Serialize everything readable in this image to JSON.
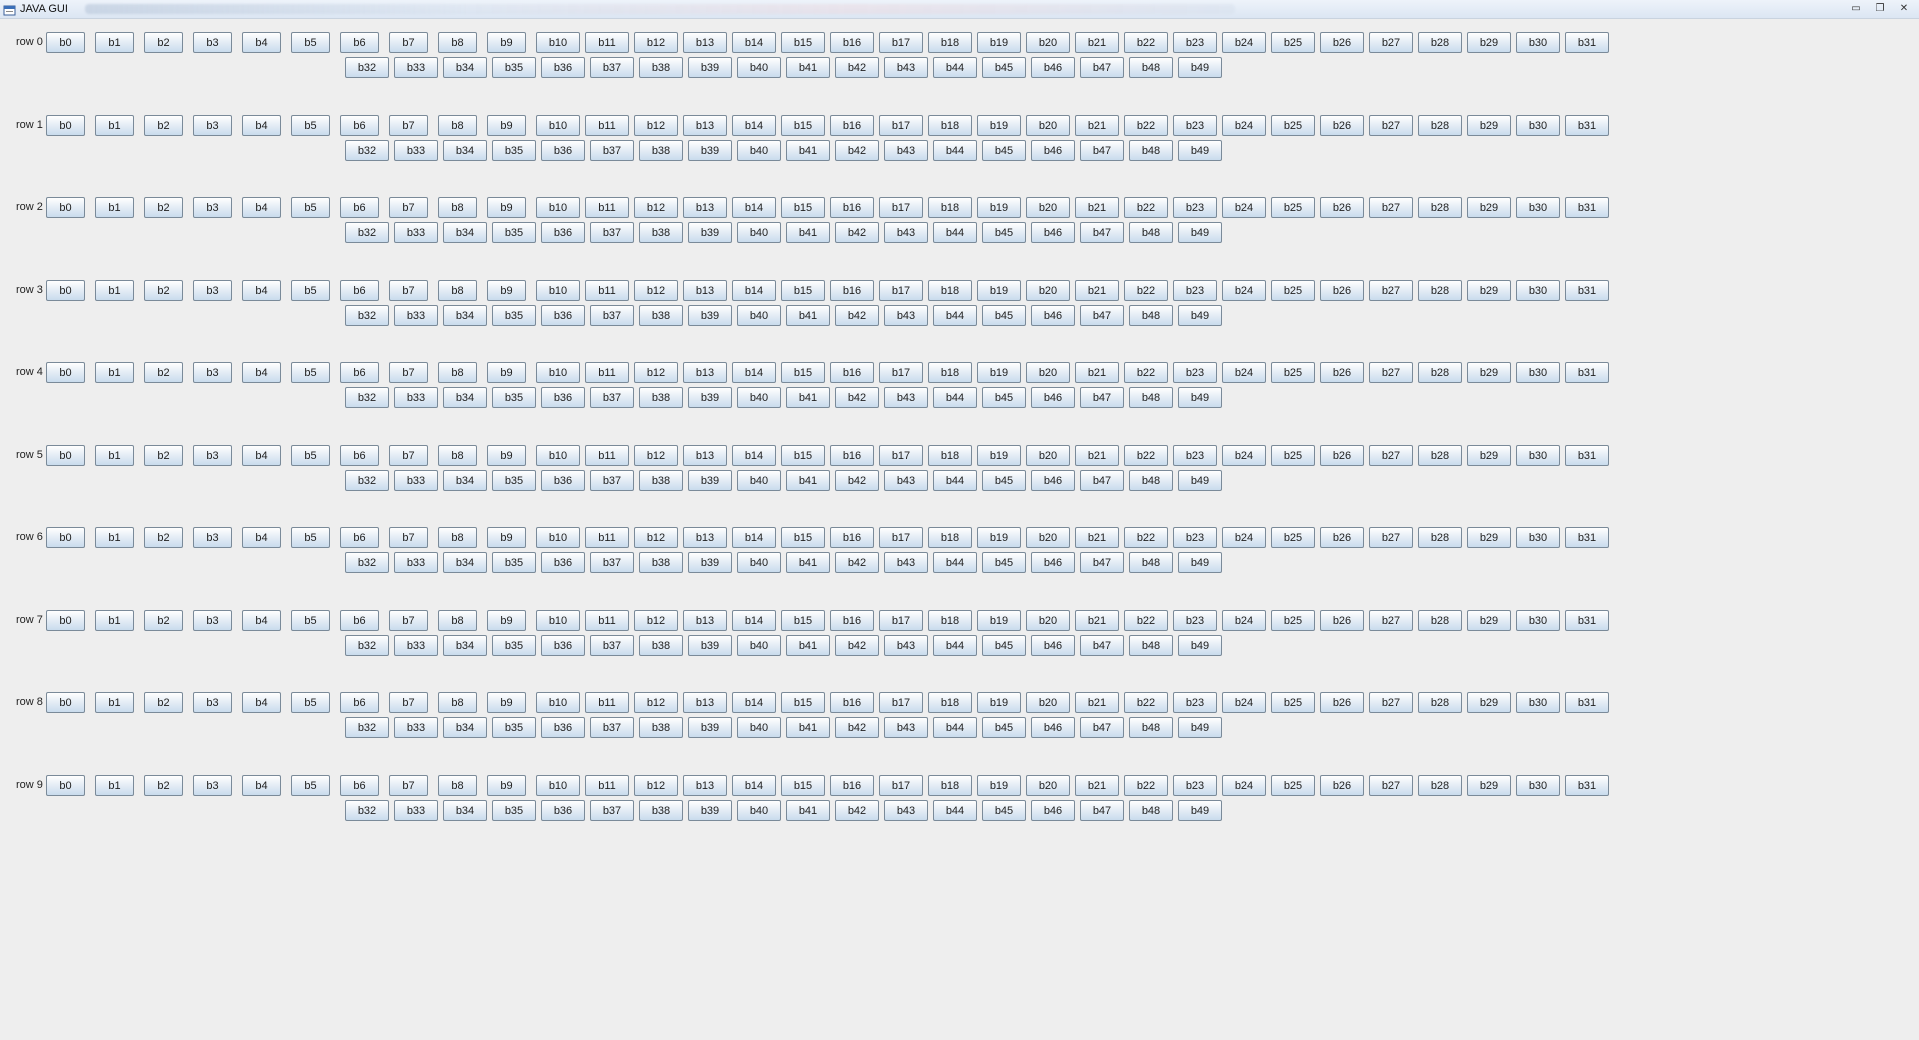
{
  "window": {
    "title": "JAVA GUI",
    "controls": {
      "minimize": "▭",
      "restore": "❐",
      "close": "✕"
    }
  },
  "rows": [
    {
      "label": "row 0",
      "buttons": [
        "b0",
        "b1",
        "b2",
        "b3",
        "b4",
        "b5",
        "b6",
        "b7",
        "b8",
        "b9",
        "b10",
        "b11",
        "b12",
        "b13",
        "b14",
        "b15",
        "b16",
        "b17",
        "b18",
        "b19",
        "b20",
        "b21",
        "b22",
        "b23",
        "b24",
        "b25",
        "b26",
        "b27",
        "b28",
        "b29",
        "b30",
        "b31",
        "b32",
        "b33",
        "b34",
        "b35",
        "b36",
        "b37",
        "b38",
        "b39",
        "b40",
        "b41",
        "b42",
        "b43",
        "b44",
        "b45",
        "b46",
        "b47",
        "b48",
        "b49"
      ]
    },
    {
      "label": "row 1",
      "buttons": [
        "b0",
        "b1",
        "b2",
        "b3",
        "b4",
        "b5",
        "b6",
        "b7",
        "b8",
        "b9",
        "b10",
        "b11",
        "b12",
        "b13",
        "b14",
        "b15",
        "b16",
        "b17",
        "b18",
        "b19",
        "b20",
        "b21",
        "b22",
        "b23",
        "b24",
        "b25",
        "b26",
        "b27",
        "b28",
        "b29",
        "b30",
        "b31",
        "b32",
        "b33",
        "b34",
        "b35",
        "b36",
        "b37",
        "b38",
        "b39",
        "b40",
        "b41",
        "b42",
        "b43",
        "b44",
        "b45",
        "b46",
        "b47",
        "b48",
        "b49"
      ]
    },
    {
      "label": "row 2",
      "buttons": [
        "b0",
        "b1",
        "b2",
        "b3",
        "b4",
        "b5",
        "b6",
        "b7",
        "b8",
        "b9",
        "b10",
        "b11",
        "b12",
        "b13",
        "b14",
        "b15",
        "b16",
        "b17",
        "b18",
        "b19",
        "b20",
        "b21",
        "b22",
        "b23",
        "b24",
        "b25",
        "b26",
        "b27",
        "b28",
        "b29",
        "b30",
        "b31",
        "b32",
        "b33",
        "b34",
        "b35",
        "b36",
        "b37",
        "b38",
        "b39",
        "b40",
        "b41",
        "b42",
        "b43",
        "b44",
        "b45",
        "b46",
        "b47",
        "b48",
        "b49"
      ]
    },
    {
      "label": "row 3",
      "buttons": [
        "b0",
        "b1",
        "b2",
        "b3",
        "b4",
        "b5",
        "b6",
        "b7",
        "b8",
        "b9",
        "b10",
        "b11",
        "b12",
        "b13",
        "b14",
        "b15",
        "b16",
        "b17",
        "b18",
        "b19",
        "b20",
        "b21",
        "b22",
        "b23",
        "b24",
        "b25",
        "b26",
        "b27",
        "b28",
        "b29",
        "b30",
        "b31",
        "b32",
        "b33",
        "b34",
        "b35",
        "b36",
        "b37",
        "b38",
        "b39",
        "b40",
        "b41",
        "b42",
        "b43",
        "b44",
        "b45",
        "b46",
        "b47",
        "b48",
        "b49"
      ]
    },
    {
      "label": "row 4",
      "buttons": [
        "b0",
        "b1",
        "b2",
        "b3",
        "b4",
        "b5",
        "b6",
        "b7",
        "b8",
        "b9",
        "b10",
        "b11",
        "b12",
        "b13",
        "b14",
        "b15",
        "b16",
        "b17",
        "b18",
        "b19",
        "b20",
        "b21",
        "b22",
        "b23",
        "b24",
        "b25",
        "b26",
        "b27",
        "b28",
        "b29",
        "b30",
        "b31",
        "b32",
        "b33",
        "b34",
        "b35",
        "b36",
        "b37",
        "b38",
        "b39",
        "b40",
        "b41",
        "b42",
        "b43",
        "b44",
        "b45",
        "b46",
        "b47",
        "b48",
        "b49"
      ]
    },
    {
      "label": "row 5",
      "buttons": [
        "b0",
        "b1",
        "b2",
        "b3",
        "b4",
        "b5",
        "b6",
        "b7",
        "b8",
        "b9",
        "b10",
        "b11",
        "b12",
        "b13",
        "b14",
        "b15",
        "b16",
        "b17",
        "b18",
        "b19",
        "b20",
        "b21",
        "b22",
        "b23",
        "b24",
        "b25",
        "b26",
        "b27",
        "b28",
        "b29",
        "b30",
        "b31",
        "b32",
        "b33",
        "b34",
        "b35",
        "b36",
        "b37",
        "b38",
        "b39",
        "b40",
        "b41",
        "b42",
        "b43",
        "b44",
        "b45",
        "b46",
        "b47",
        "b48",
        "b49"
      ]
    },
    {
      "label": "row 6",
      "buttons": [
        "b0",
        "b1",
        "b2",
        "b3",
        "b4",
        "b5",
        "b6",
        "b7",
        "b8",
        "b9",
        "b10",
        "b11",
        "b12",
        "b13",
        "b14",
        "b15",
        "b16",
        "b17",
        "b18",
        "b19",
        "b20",
        "b21",
        "b22",
        "b23",
        "b24",
        "b25",
        "b26",
        "b27",
        "b28",
        "b29",
        "b30",
        "b31",
        "b32",
        "b33",
        "b34",
        "b35",
        "b36",
        "b37",
        "b38",
        "b39",
        "b40",
        "b41",
        "b42",
        "b43",
        "b44",
        "b45",
        "b46",
        "b47",
        "b48",
        "b49"
      ]
    },
    {
      "label": "row 7",
      "buttons": [
        "b0",
        "b1",
        "b2",
        "b3",
        "b4",
        "b5",
        "b6",
        "b7",
        "b8",
        "b9",
        "b10",
        "b11",
        "b12",
        "b13",
        "b14",
        "b15",
        "b16",
        "b17",
        "b18",
        "b19",
        "b20",
        "b21",
        "b22",
        "b23",
        "b24",
        "b25",
        "b26",
        "b27",
        "b28",
        "b29",
        "b30",
        "b31",
        "b32",
        "b33",
        "b34",
        "b35",
        "b36",
        "b37",
        "b38",
        "b39",
        "b40",
        "b41",
        "b42",
        "b43",
        "b44",
        "b45",
        "b46",
        "b47",
        "b48",
        "b49"
      ]
    },
    {
      "label": "row 8",
      "buttons": [
        "b0",
        "b1",
        "b2",
        "b3",
        "b4",
        "b5",
        "b6",
        "b7",
        "b8",
        "b9",
        "b10",
        "b11",
        "b12",
        "b13",
        "b14",
        "b15",
        "b16",
        "b17",
        "b18",
        "b19",
        "b20",
        "b21",
        "b22",
        "b23",
        "b24",
        "b25",
        "b26",
        "b27",
        "b28",
        "b29",
        "b30",
        "b31",
        "b32",
        "b33",
        "b34",
        "b35",
        "b36",
        "b37",
        "b38",
        "b39",
        "b40",
        "b41",
        "b42",
        "b43",
        "b44",
        "b45",
        "b46",
        "b47",
        "b48",
        "b49"
      ]
    },
    {
      "label": "row 9",
      "buttons": [
        "b0",
        "b1",
        "b2",
        "b3",
        "b4",
        "b5",
        "b6",
        "b7",
        "b8",
        "b9",
        "b10",
        "b11",
        "b12",
        "b13",
        "b14",
        "b15",
        "b16",
        "b17",
        "b18",
        "b19",
        "b20",
        "b21",
        "b22",
        "b23",
        "b24",
        "b25",
        "b26",
        "b27",
        "b28",
        "b29",
        "b30",
        "b31",
        "b32",
        "b33",
        "b34",
        "b35",
        "b36",
        "b37",
        "b38",
        "b39",
        "b40",
        "b41",
        "b42",
        "b43",
        "b44",
        "b45",
        "b46",
        "b47",
        "b48",
        "b49"
      ]
    }
  ]
}
